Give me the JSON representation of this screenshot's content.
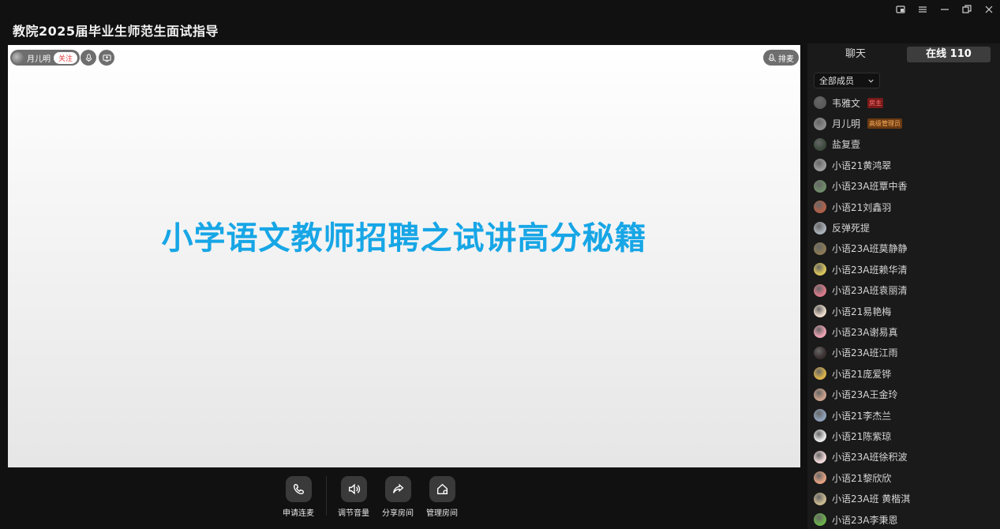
{
  "window": {
    "title": "教院2025届毕业生师范生面试指导",
    "controls": [
      "pip-icon",
      "menu-icon",
      "minimize-icon",
      "restore-icon",
      "close-icon"
    ]
  },
  "stage": {
    "presenter_name": "月儿明",
    "follow_label": "关注",
    "queue_label": "排麦",
    "slide_title": "小学语文教师招聘之试讲高分秘籍"
  },
  "controls": {
    "apply_mic": "申请连麦",
    "volume": "调节音量",
    "share_room": "分享房间",
    "manage_room": "管理房间"
  },
  "sidebar": {
    "tab_chat": "聊天",
    "tab_online": "在线 110",
    "filter_label": "全部成员",
    "members": [
      {
        "name": "韦雅文",
        "role": "房主",
        "role_type": "owner",
        "color": "#5a5a5a"
      },
      {
        "name": "月儿明",
        "role": "高级管理员",
        "role_type": "admin",
        "color": "#8a8a8a"
      },
      {
        "name": "盐复壹",
        "role": "",
        "role_type": "",
        "color": "#3c4a3c"
      },
      {
        "name": "小语21黄鸿翠",
        "role": "",
        "role_type": "",
        "color": "#9a9a9a"
      },
      {
        "name": "小语23A班覃中香",
        "role": "",
        "role_type": "",
        "color": "#6f8a6a"
      },
      {
        "name": "小语21刘鑫羽",
        "role": "",
        "role_type": "",
        "color": "#b0614a"
      },
      {
        "name": "反弹死提",
        "role": "",
        "role_type": "",
        "color": "#aab0b8"
      },
      {
        "name": "小语23A班莫静静",
        "role": "",
        "role_type": "",
        "color": "#8a7a55"
      },
      {
        "name": "小语23A班赖华清",
        "role": "",
        "role_type": "",
        "color": "#d9c35a"
      },
      {
        "name": "小语23A班袁丽清",
        "role": "",
        "role_type": "",
        "color": "#d97a8a"
      },
      {
        "name": "小语21易艳梅",
        "role": "",
        "role_type": "",
        "color": "#e8d8c8"
      },
      {
        "name": "小语23A谢易真",
        "role": "",
        "role_type": "",
        "color": "#e9a0b0"
      },
      {
        "name": "小语23A班江雨",
        "role": "",
        "role_type": "",
        "color": "#3a3030"
      },
      {
        "name": "小语21庞爱铧",
        "role": "",
        "role_type": "",
        "color": "#d8b04a"
      },
      {
        "name": "小语23A王金玲",
        "role": "",
        "role_type": "",
        "color": "#c9a08a"
      },
      {
        "name": "小语21李杰兰",
        "role": "",
        "role_type": "",
        "color": "#8fa0b8"
      },
      {
        "name": "小语21陈紫琼",
        "role": "",
        "role_type": "",
        "color": "#e8e8e8"
      },
      {
        "name": "小语23A班徐积波",
        "role": "",
        "role_type": "",
        "color": "#f0d8d8"
      },
      {
        "name": "小语21黎欣欣",
        "role": "",
        "role_type": "",
        "color": "#e0a080"
      },
      {
        "name": "小语23A班 黄楷淇",
        "role": "",
        "role_type": "",
        "color": "#c8b890"
      },
      {
        "name": "小语23A李秉恩",
        "role": "",
        "role_type": "",
        "color": "#6ab04a"
      }
    ]
  }
}
